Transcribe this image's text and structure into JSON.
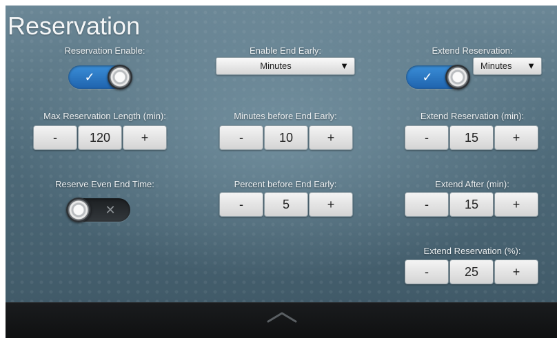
{
  "title": "Reservation",
  "col1": {
    "enable_label": "Reservation Enable:",
    "enable_icon": "check-icon",
    "enable_glyph": "✓",
    "max_label": "Max Reservation Length (min):",
    "max_value": "120",
    "even_label": "Reserve Even End Time:",
    "even_icon": "x-icon",
    "even_glyph": "✕"
  },
  "col2": {
    "end_early_label": "Enable End Early:",
    "end_early_value": "Minutes",
    "minutes_before_label": "Minutes before End Early:",
    "minutes_before_value": "10",
    "percent_before_label": "Percent before End Early:",
    "percent_before_value": "5"
  },
  "col3": {
    "extend_label": "Extend Reservation:",
    "extend_unit": "Minutes",
    "extend_icon": "check-icon",
    "extend_glyph": "✓",
    "extend_min_label": "Extend Reservation (min):",
    "extend_min_value": "15",
    "extend_after_label": "Extend After (min):",
    "extend_after_value": "15",
    "extend_pct_label": "Extend Reservation (%):",
    "extend_pct_value": "25"
  },
  "stepper": {
    "minus": "-",
    "plus": "+"
  },
  "colors": {
    "toggle_on": "#2a74c2",
    "toggle_off": "#22272b",
    "footer": "#141617"
  }
}
